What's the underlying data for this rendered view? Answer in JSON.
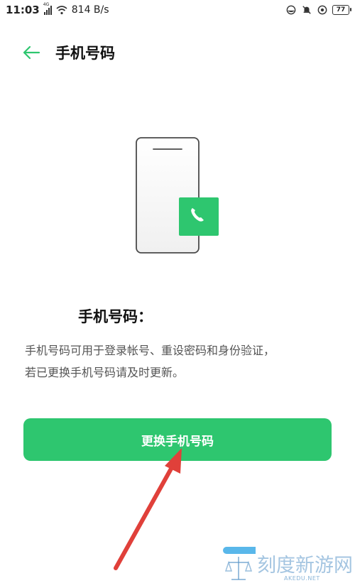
{
  "status_bar": {
    "time": "11:03",
    "network_speed": "814 B/s",
    "signal_badge": "4G",
    "battery_level": "77"
  },
  "app_bar": {
    "back_icon": "back-arrow-icon",
    "title": "手机号码"
  },
  "content": {
    "heading": "手机号码：",
    "description_line1": "手机号码可用于登录帐号、重设密码和身份验证，",
    "description_line2": "若已更换手机号码请及时更新。"
  },
  "actions": {
    "change_phone_label": "更换手机号码"
  },
  "watermark": {
    "text": "刻度新游网",
    "sub": "AKEDU.NET"
  },
  "colors": {
    "accent": "#2ec66f",
    "annotation_arrow": "#e0403a"
  }
}
